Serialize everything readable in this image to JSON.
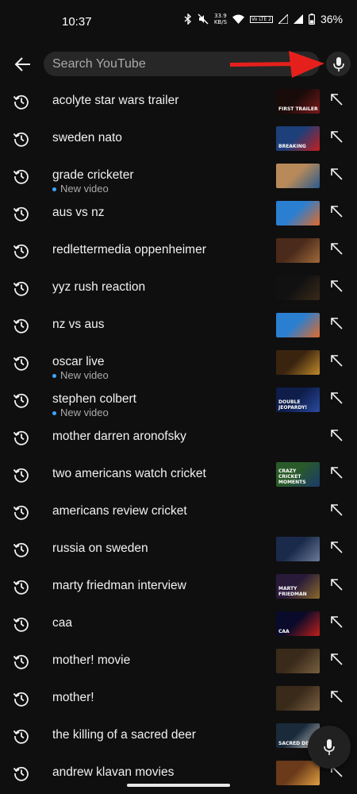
{
  "status": {
    "time": "10:37",
    "net_speed_value": "33.9",
    "net_speed_unit": "KB/S",
    "lte_badge": "Vo LTE 2",
    "battery": "36%"
  },
  "search": {
    "placeholder": "Search YouTube",
    "value": ""
  },
  "suggestions": [
    {
      "query": "acolyte star wars trailer",
      "subtitle": "",
      "has_thumbnail": true,
      "thumb_text": "FIRST TRAILER",
      "thumb_colors": [
        "#1a0b0b",
        "#7a1818"
      ]
    },
    {
      "query": "sweden nato",
      "subtitle": "",
      "has_thumbnail": true,
      "thumb_text": "BREAKING",
      "thumb_colors": [
        "#1d3f7a",
        "#c41d1d"
      ]
    },
    {
      "query": "grade cricketer",
      "subtitle": "New video",
      "has_thumbnail": true,
      "thumb_text": "",
      "thumb_colors": [
        "#b88a5a",
        "#2b5a8c"
      ]
    },
    {
      "query": "aus vs nz",
      "subtitle": "",
      "has_thumbnail": true,
      "thumb_text": "",
      "thumb_colors": [
        "#2a7fd1",
        "#e06a2a"
      ]
    },
    {
      "query": "redlettermedia oppenheimer",
      "subtitle": "",
      "has_thumbnail": true,
      "thumb_text": "",
      "thumb_colors": [
        "#4a2a1a",
        "#a06a3a"
      ]
    },
    {
      "query": "yyz rush reaction",
      "subtitle": "",
      "has_thumbnail": true,
      "thumb_text": "",
      "thumb_colors": [
        "#111111",
        "#3a2a1a"
      ]
    },
    {
      "query": "nz vs aus",
      "subtitle": "",
      "has_thumbnail": true,
      "thumb_text": "",
      "thumb_colors": [
        "#2a7fd1",
        "#e06a2a"
      ]
    },
    {
      "query": "oscar live",
      "subtitle": "New video",
      "has_thumbnail": true,
      "thumb_text": "",
      "thumb_colors": [
        "#3a2410",
        "#c08a2a"
      ]
    },
    {
      "query": "stephen colbert",
      "subtitle": "New video",
      "has_thumbnail": true,
      "thumb_text": "DOUBLE JEOPARDY!",
      "thumb_colors": [
        "#0e1d4a",
        "#2a4aa0"
      ]
    },
    {
      "query": "mother darren aronofsky",
      "subtitle": "",
      "has_thumbnail": false,
      "thumb_text": "",
      "thumb_colors": []
    },
    {
      "query": "two americans watch cricket",
      "subtitle": "",
      "has_thumbnail": true,
      "thumb_text": "CRAZY CRICKET MOMENTS",
      "thumb_colors": [
        "#2a5a2a",
        "#1a3a6a"
      ]
    },
    {
      "query": "americans review cricket",
      "subtitle": "",
      "has_thumbnail": false,
      "thumb_text": "",
      "thumb_colors": []
    },
    {
      "query": "russia on sweden",
      "subtitle": "",
      "has_thumbnail": true,
      "thumb_text": "",
      "thumb_colors": [
        "#1a2a4a",
        "#6a7a9a"
      ]
    },
    {
      "query": "marty friedman interview",
      "subtitle": "",
      "has_thumbnail": true,
      "thumb_text": "MARTY FRIEDMAN",
      "thumb_colors": [
        "#2a1a3a",
        "#8a6a2a"
      ]
    },
    {
      "query": "caa",
      "subtitle": "",
      "has_thumbnail": true,
      "thumb_text": "CAA",
      "thumb_colors": [
        "#0a0a2a",
        "#c0201a"
      ]
    },
    {
      "query": "mother! movie",
      "subtitle": "",
      "has_thumbnail": true,
      "thumb_text": "",
      "thumb_colors": [
        "#3a2a1a",
        "#7a6040"
      ]
    },
    {
      "query": "mother!",
      "subtitle": "",
      "has_thumbnail": true,
      "thumb_text": "",
      "thumb_colors": [
        "#3a2a1a",
        "#7a6040"
      ]
    },
    {
      "query": "the killing of a sacred deer",
      "subtitle": "",
      "has_thumbnail": true,
      "thumb_text": "SACRED DEER",
      "thumb_colors": [
        "#1a2a3a",
        "#c8c8c8"
      ]
    },
    {
      "query": "andrew klavan movies",
      "subtitle": "",
      "has_thumbnail": true,
      "thumb_text": "",
      "thumb_colors": [
        "#6a3a1a",
        "#e0a040"
      ]
    }
  ],
  "colors": {
    "background": "#0f0f0f",
    "search_field": "#272727",
    "new_video_dot": "#3ea6ff",
    "annotation_arrow": "#e5201c",
    "secondary_text": "#aaaaaa"
  },
  "icons": {
    "back": "arrow-left-icon",
    "voice": "microphone-icon",
    "history": "history-icon",
    "fill_query": "arrow-up-left-icon"
  }
}
